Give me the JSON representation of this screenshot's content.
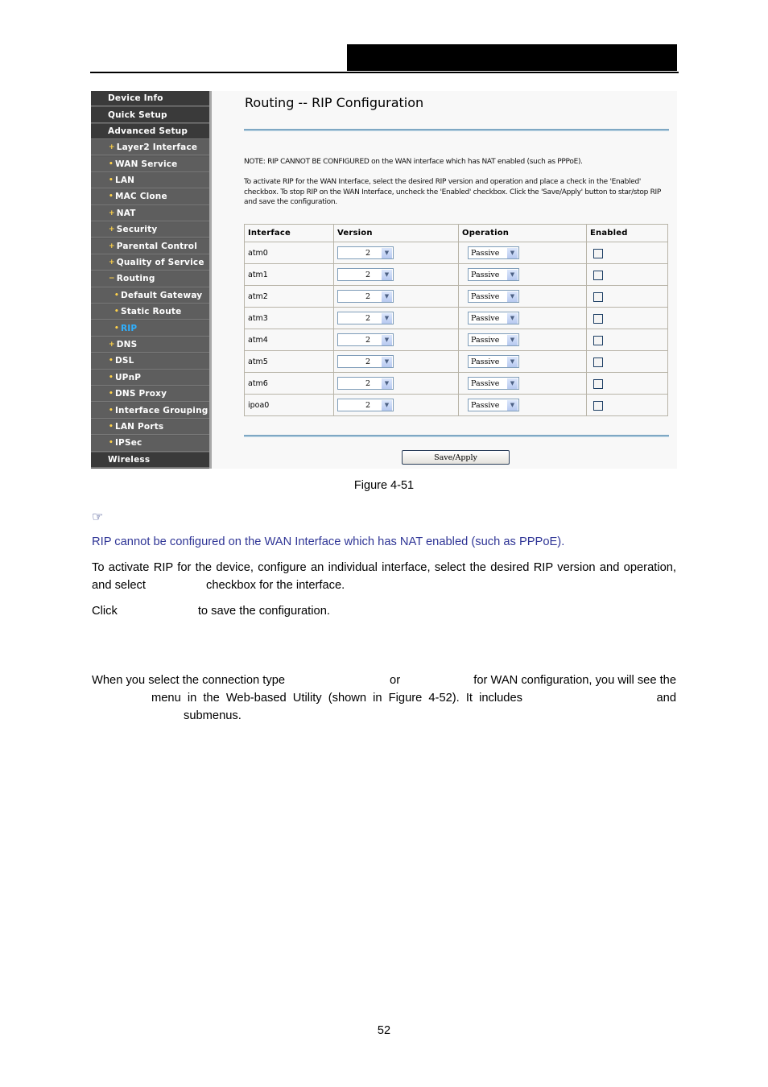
{
  "screenshot": {
    "sidebar": {
      "items": [
        {
          "label": "Device Info",
          "level": "top"
        },
        {
          "label": "Quick Setup",
          "level": "top"
        },
        {
          "label": "Advanced Setup",
          "level": "top"
        },
        {
          "label": "Layer2 Interface",
          "level": "sub",
          "bullet": "+"
        },
        {
          "label": "WAN Service",
          "level": "sub",
          "bullet": "•"
        },
        {
          "label": "LAN",
          "level": "sub",
          "bullet": "•"
        },
        {
          "label": "MAC Clone",
          "level": "sub",
          "bullet": "•"
        },
        {
          "label": "NAT",
          "level": "sub",
          "bullet": "+"
        },
        {
          "label": "Security",
          "level": "sub",
          "bullet": "+"
        },
        {
          "label": "Parental Control",
          "level": "sub",
          "bullet": "+"
        },
        {
          "label": "Quality of Service",
          "level": "sub",
          "bullet": "+"
        },
        {
          "label": "Routing",
          "level": "sub",
          "bullet": "−"
        },
        {
          "label": "Default Gateway",
          "level": "sub2",
          "bullet": "•"
        },
        {
          "label": "Static Route",
          "level": "sub2",
          "bullet": "•"
        },
        {
          "label": "RIP",
          "level": "sub2",
          "bullet": "•",
          "active": true
        },
        {
          "label": "DNS",
          "level": "sub",
          "bullet": "+"
        },
        {
          "label": "DSL",
          "level": "sub",
          "bullet": "•"
        },
        {
          "label": "UPnP",
          "level": "sub",
          "bullet": "•"
        },
        {
          "label": "DNS Proxy",
          "level": "sub",
          "bullet": "•"
        },
        {
          "label": "Interface Grouping",
          "level": "sub",
          "bullet": "•"
        },
        {
          "label": "LAN Ports",
          "level": "sub",
          "bullet": "•"
        },
        {
          "label": "IPSec",
          "level": "sub",
          "bullet": "•"
        },
        {
          "label": "Wireless",
          "level": "top"
        }
      ]
    },
    "page_title": "Routing -- RIP Configuration",
    "note": "NOTE: RIP CANNOT BE CONFIGURED on the WAN interface which has NAT enabled (such as PPPoE).",
    "description": "To activate RIP for the WAN Interface, select the desired RIP version and operation and place a check in the 'Enabled' checkbox. To stop RIP on the WAN Interface, uncheck the 'Enabled' checkbox. Click the 'Save/Apply' button to star/stop RIP and save the configuration.",
    "table": {
      "headers": [
        "Interface",
        "Version",
        "Operation",
        "Enabled"
      ],
      "rows": [
        {
          "interface": "atm0",
          "version": "2",
          "operation": "Passive",
          "enabled": false
        },
        {
          "interface": "atm1",
          "version": "2",
          "operation": "Passive",
          "enabled": false
        },
        {
          "interface": "atm2",
          "version": "2",
          "operation": "Passive",
          "enabled": false
        },
        {
          "interface": "atm3",
          "version": "2",
          "operation": "Passive",
          "enabled": false
        },
        {
          "interface": "atm4",
          "version": "2",
          "operation": "Passive",
          "enabled": false
        },
        {
          "interface": "atm5",
          "version": "2",
          "operation": "Passive",
          "enabled": false
        },
        {
          "interface": "atm6",
          "version": "2",
          "operation": "Passive",
          "enabled": false
        },
        {
          "interface": "ipoa0",
          "version": "2",
          "operation": "Passive",
          "enabled": false
        }
      ]
    },
    "save_button": "Save/Apply"
  },
  "document": {
    "figure_caption": "Figure 4-51",
    "note_icon": "pointing-hand-icon",
    "note_text": "RIP cannot be configured on the WAN Interface which has NAT enabled (such as PPPoE).",
    "para1_a": "To activate RIP for the device, configure an individual interface, select the desired RIP version and operation, and select",
    "para1_b": "checkbox for the interface.",
    "para2_a": "Click",
    "para2_b": "to save the configuration.",
    "para3_a": "When you select the connection type",
    "para3_b": "or",
    "para3_c": "for WAN configuration, you will see the",
    "para3_d": "menu in the Web-based Utility (shown in Figure 4-52). It includes",
    "para3_e": "and",
    "para3_f": "submenus.",
    "page_number": "52"
  },
  "colors": {
    "note_blue": "#2f3596",
    "sidebar_active": "#2fb0ff",
    "sidebar_bullet": "#ffd24a"
  }
}
